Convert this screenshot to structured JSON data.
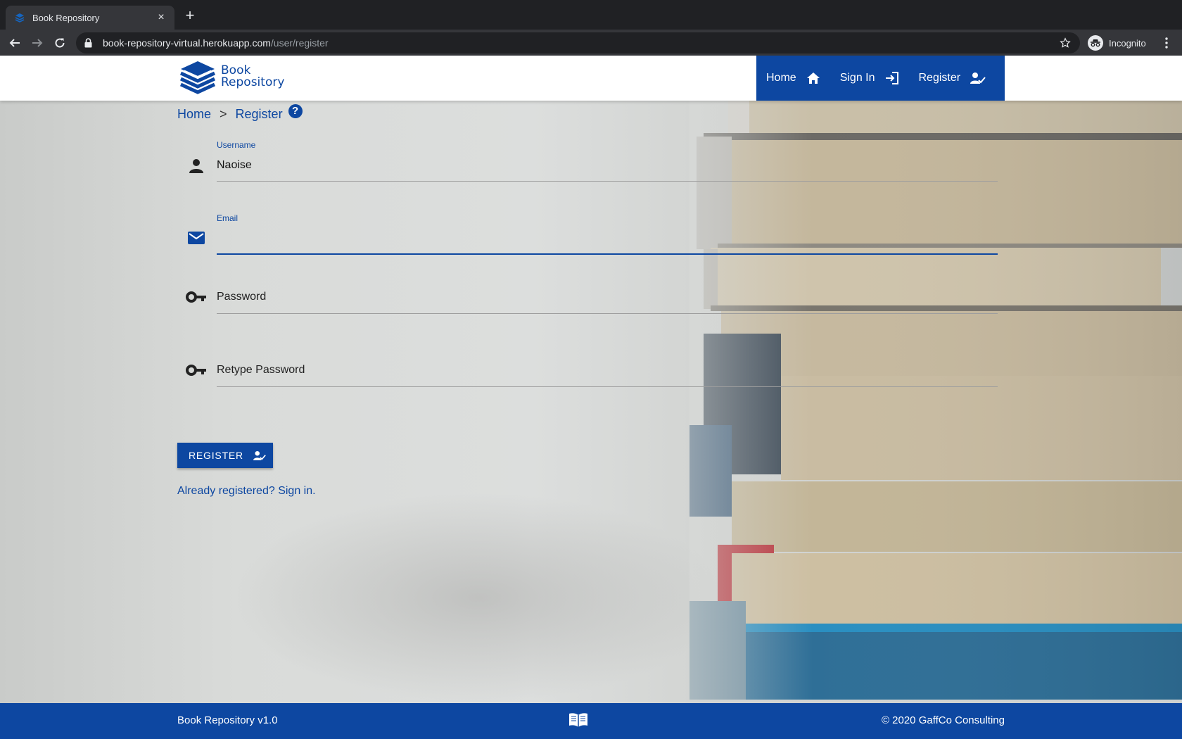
{
  "browser": {
    "tab_title": "Book Repository",
    "new_tab": "+",
    "tab_close": "×",
    "url_host": "book-repository-virtual.herokuapp.com",
    "url_path": "/user/register",
    "profile_label": "Incognito"
  },
  "header": {
    "logo_line1": "Book",
    "logo_line2": "Repository",
    "nav": [
      {
        "label": "Home",
        "icon": "home-icon"
      },
      {
        "label": "Sign In",
        "icon": "login-icon"
      },
      {
        "label": "Register",
        "icon": "person-check-icon"
      }
    ]
  },
  "breadcrumb": {
    "home": "Home",
    "separator": ">",
    "current": "Register",
    "help": "?"
  },
  "form": {
    "username": {
      "label": "Username",
      "value": "Naoise",
      "icon": "person-icon"
    },
    "email": {
      "label": "Email",
      "value": "",
      "icon": "mail-icon"
    },
    "password": {
      "placeholder": "Password",
      "icon": "key-icon"
    },
    "retype_password": {
      "placeholder": "Retype Password",
      "icon": "key-icon"
    },
    "submit_label": "REGISTER",
    "signin_text": "Already registered? Sign in."
  },
  "footer": {
    "left": "Book Repository v1.0",
    "center_icon": "open-book-icon",
    "right": "© 2020 GaffCo Consulting"
  },
  "colors": {
    "primary": "#0d47a1",
    "chrome_dark": "#202124",
    "chrome_tab": "#35363a"
  }
}
